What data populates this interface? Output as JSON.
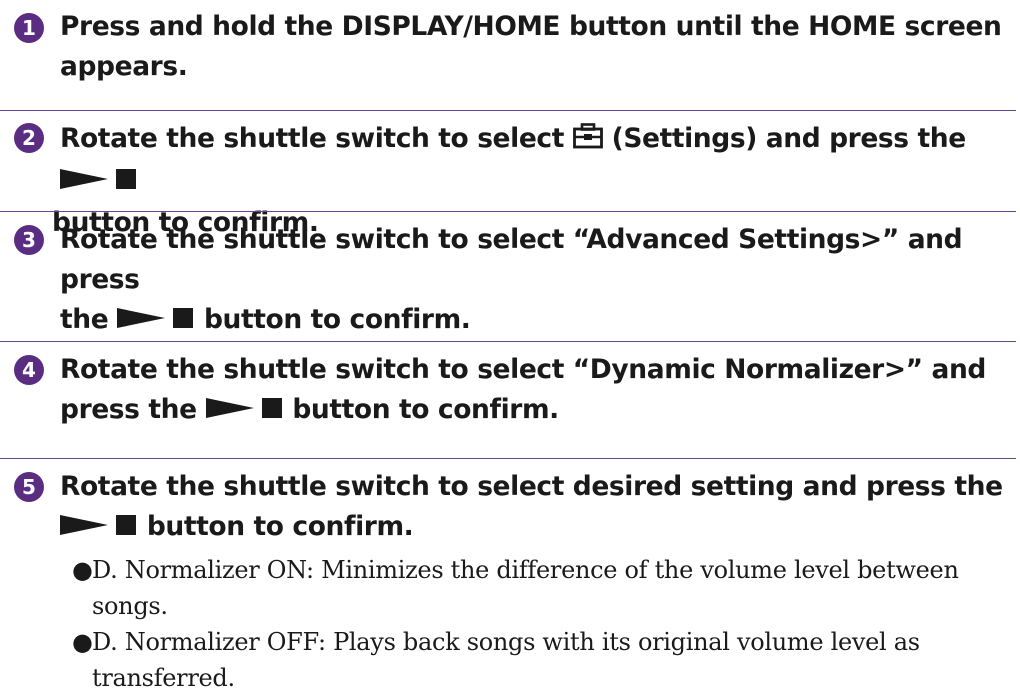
{
  "steps": [
    {
      "number": "1",
      "line1": "Press and hold the DISPLAY/HOME button until the HOME screen",
      "line2": "appears."
    },
    {
      "number": "2",
      "line1_before_icon": "Rotate the shuttle switch to select ",
      "line1_after_icon": " (Settings) and press the ",
      "icon": "settings-toolbox-icon",
      "line2_after_icon": " button to confirm."
    },
    {
      "number": "3",
      "line1": "Rotate the shuttle switch to select “Advanced Settings>” and press",
      "line2_before_icon": "the ",
      "line2_after_icon": " button to confirm."
    },
    {
      "number": "4",
      "line1": "Rotate the shuttle switch to select “Dynamic Normalizer>” and",
      "line2_before_icon": "press the ",
      "line2_after_icon": " button to confirm."
    },
    {
      "number": "5",
      "line1": "Rotate the shuttle switch to select desired setting and press the",
      "line2_after_icon": " button to confirm.",
      "bullets": [
        {
          "line1": "D. Normalizer ON: Minimizes the difference of the volume level between",
          "line2": "songs."
        },
        {
          "line1": "D. Normalizer OFF: Plays back songs with its original volume level as",
          "line2": "transferred."
        }
      ]
    }
  ],
  "bullet_char": "●",
  "colors": {
    "accent": "#5a2d82",
    "divider": "#6a4690",
    "text": "#1a1a1a"
  }
}
